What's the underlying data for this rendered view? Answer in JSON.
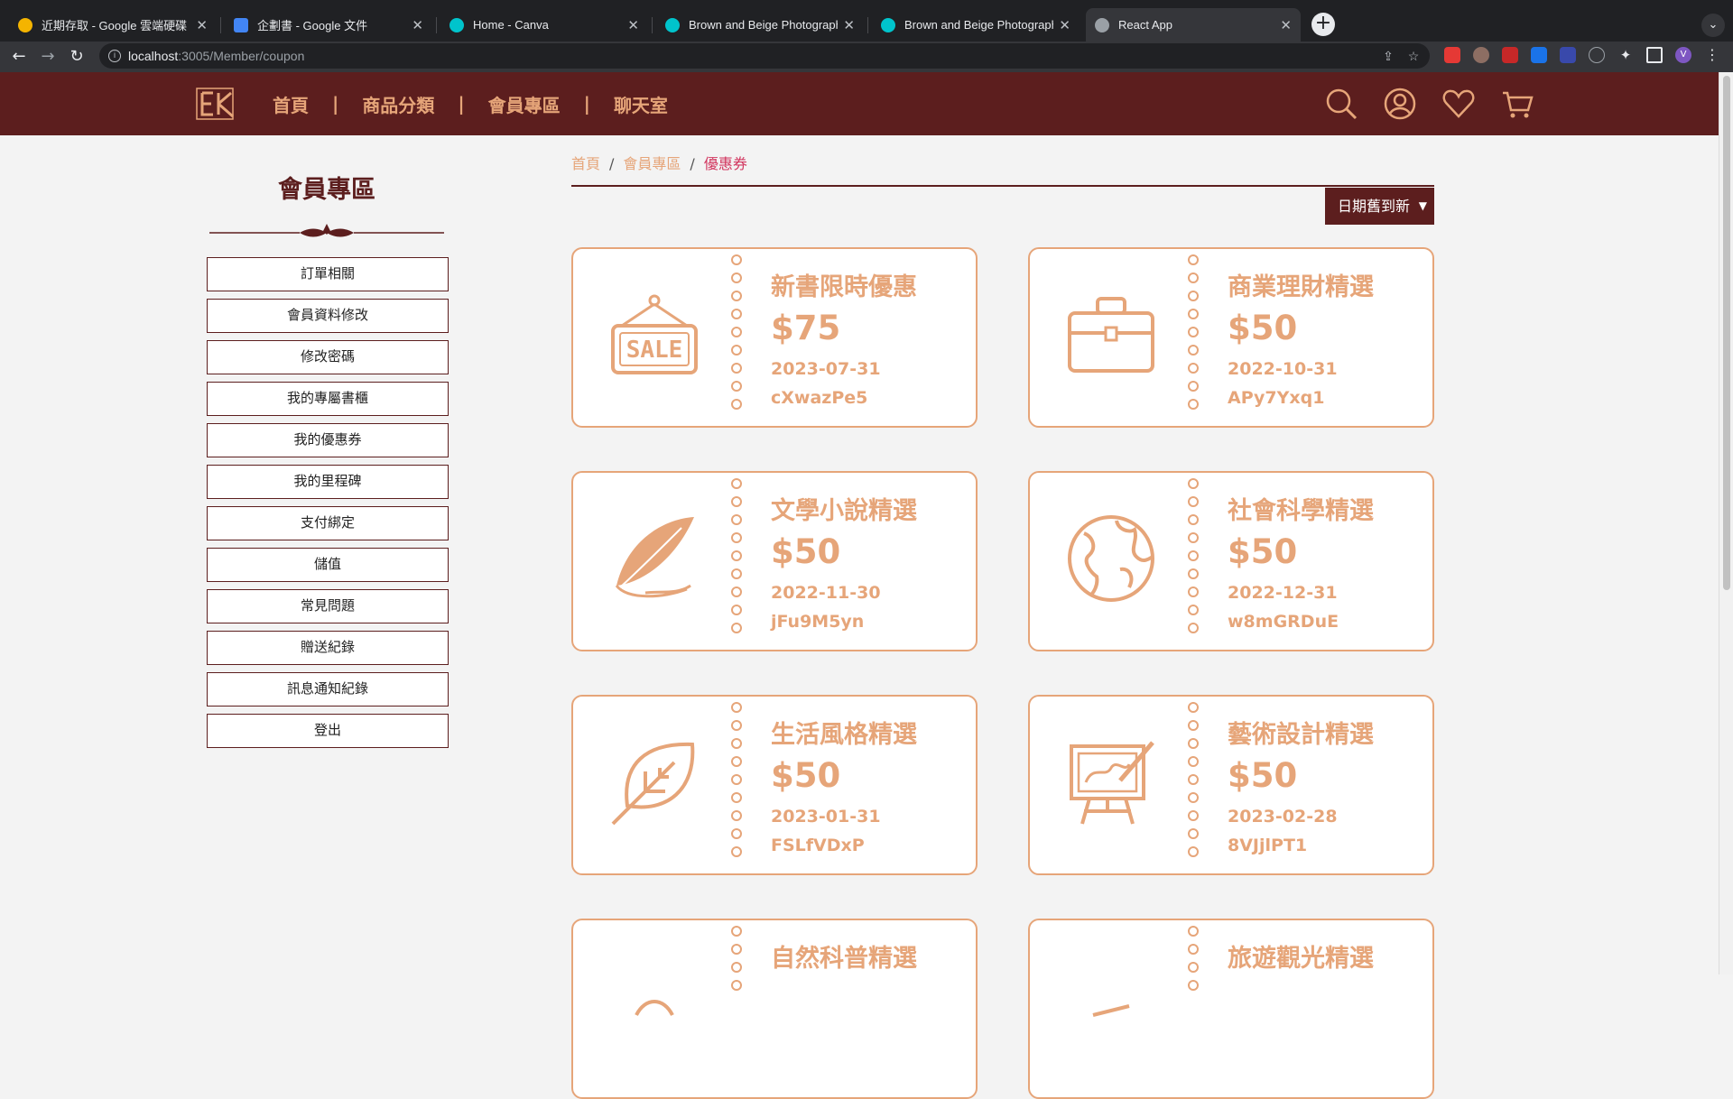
{
  "browser": {
    "tabs": [
      {
        "title": "近期存取 - Google 雲端硬碟",
        "favicon": "google-drive-icon",
        "color": "#f4b400"
      },
      {
        "title": "企劃書 - Google 文件",
        "favicon": "google-docs-icon",
        "color": "#4285f4"
      },
      {
        "title": "Home - Canva",
        "favicon": "canva-icon",
        "color": "#00c4cc"
      },
      {
        "title": "Brown and Beige Photography",
        "favicon": "canva-icon",
        "color": "#00c4cc"
      },
      {
        "title": "Brown and Beige Photography",
        "favicon": "canva-icon",
        "color": "#00c4cc"
      },
      {
        "title": "React App",
        "favicon": "globe-icon",
        "color": "#9aa0a6"
      }
    ],
    "url_host": "localhost",
    "url_path": ":3005/Member/coupon"
  },
  "header": {
    "nav": [
      "首頁",
      "商品分類",
      "會員專區",
      "聊天室"
    ],
    "separator": "|"
  },
  "sidebar": {
    "title": "會員專區",
    "items": [
      "訂單相關",
      "會員資料修改",
      "修改密碼",
      "我的專屬書櫃",
      "我的優惠券",
      "我的里程碑",
      "支付綁定",
      "儲值",
      "常見問題",
      "贈送紀錄",
      "訊息通知紀錄",
      "登出"
    ]
  },
  "breadcrumb": {
    "items": [
      "首頁",
      "會員專區",
      "優惠券"
    ],
    "separator": "/"
  },
  "sort": {
    "label": "日期舊到新"
  },
  "coupons": [
    {
      "title": "新書限時優惠",
      "price": "$75",
      "date": "2023-07-31",
      "code": "cXwazPe5",
      "icon": "sale-sign-icon"
    },
    {
      "title": "商業理財精選",
      "price": "$50",
      "date": "2022-10-31",
      "code": "APy7Yxq1",
      "icon": "briefcase-icon"
    },
    {
      "title": "文學小說精選",
      "price": "$50",
      "date": "2022-11-30",
      "code": "jFu9M5yn",
      "icon": "feather-icon"
    },
    {
      "title": "社會科學精選",
      "price": "$50",
      "date": "2022-12-31",
      "code": "w8mGRDuE",
      "icon": "globe-icon"
    },
    {
      "title": "生活風格精選",
      "price": "$50",
      "date": "2023-01-31",
      "code": "FSLfVDxP",
      "icon": "leaf-icon"
    },
    {
      "title": "藝術設計精選",
      "price": "$50",
      "date": "2023-02-28",
      "code": "8VJjlPT1",
      "icon": "easel-icon"
    },
    {
      "title": "自然科普精選",
      "icon": "nature-icon"
    },
    {
      "title": "旅遊觀光精選",
      "icon": "travel-icon"
    }
  ],
  "colors": {
    "primary": "#5c1e1e",
    "accent": "#e6a579",
    "active_crumb": "#d2365f"
  }
}
